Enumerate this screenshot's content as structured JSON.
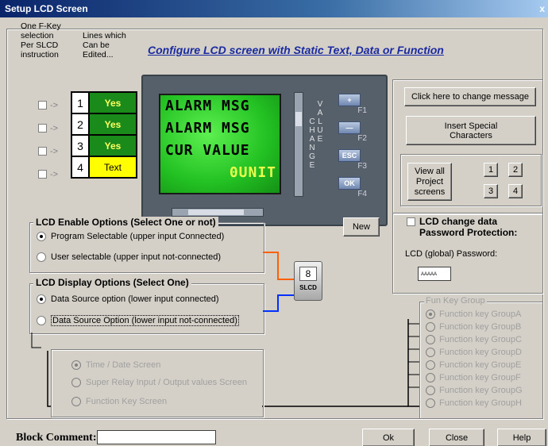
{
  "window": {
    "title": "Setup LCD Screen",
    "close": "x"
  },
  "header": {
    "fkey_note": [
      "One F-Key",
      "selection",
      "Per SLCD",
      "instruction"
    ],
    "lines_note": [
      "Lines which",
      "Can be",
      "Edited..."
    ],
    "heading": "Configure LCD screen with Static Text, Data or Function"
  },
  "line_rows": [
    {
      "num": "1",
      "value": "Yes",
      "arrow": "->"
    },
    {
      "num": "2",
      "value": "Yes",
      "arrow": "->"
    },
    {
      "num": "3",
      "value": "Yes",
      "arrow": "->"
    },
    {
      "num": "4",
      "value": "Text",
      "arrow": "->"
    }
  ],
  "lcd": {
    "lines": [
      "ALARM MSG",
      "ALARM MSG",
      "CUR VALUE",
      "0UNIT"
    ],
    "change_letters": [
      "C",
      "H",
      "A",
      "N",
      "G",
      "E"
    ],
    "value_letters": [
      "V",
      "A",
      "L",
      "U",
      "E"
    ],
    "fkeys": [
      {
        "label": "+",
        "f": "F1"
      },
      {
        "label": "—",
        "f": "F2"
      },
      {
        "label": "ESC",
        "f": "F3"
      },
      {
        "label": "OK",
        "f": "F4"
      }
    ]
  },
  "right_panel": {
    "change_message": "Click here to change message",
    "insert_special": "Insert Special Characters",
    "view_all": "View all Project screens",
    "screens": [
      "1",
      "2",
      "3",
      "4"
    ],
    "password_protect": "LCD change data Password Protection:",
    "global_password_label": "LCD (global) Password:",
    "password_value": "AAAAA"
  },
  "new_button": "New",
  "enable_options": {
    "title": "LCD Enable Options (Select One or not)",
    "options": [
      "Program Selectable (upper input Connected)",
      "User selectable (upper input not-connected)"
    ]
  },
  "display_options": {
    "title": "LCD Display Options (Select One)",
    "options": [
      "Data Source option (lower input connected)",
      "Data Source Option (lower input not-connected)"
    ]
  },
  "block": {
    "num": "8",
    "label": "SLCD"
  },
  "screen_type": {
    "options": [
      "Time / Date Screen",
      "Super Relay Input / Output values Screen",
      "Function Key Screen"
    ]
  },
  "fun_key_group": {
    "title": "Fun Key Group",
    "items": [
      "Function key GroupA",
      "Function key GroupB",
      "Function key GroupC",
      "Function key GroupD",
      "Function key GroupE",
      "Function key GroupF",
      "Function key GroupG",
      "Function key GroupH"
    ]
  },
  "footer": {
    "comment_label": "Block Comment:",
    "comment_value": "",
    "ok": "Ok",
    "close": "Close",
    "help": "Help"
  },
  "colors": {
    "lcd_green": "#22c022",
    "accent_blue": "#1a2aa0",
    "orange_wire": "#ff6000",
    "blue_wire": "#0030ff"
  }
}
